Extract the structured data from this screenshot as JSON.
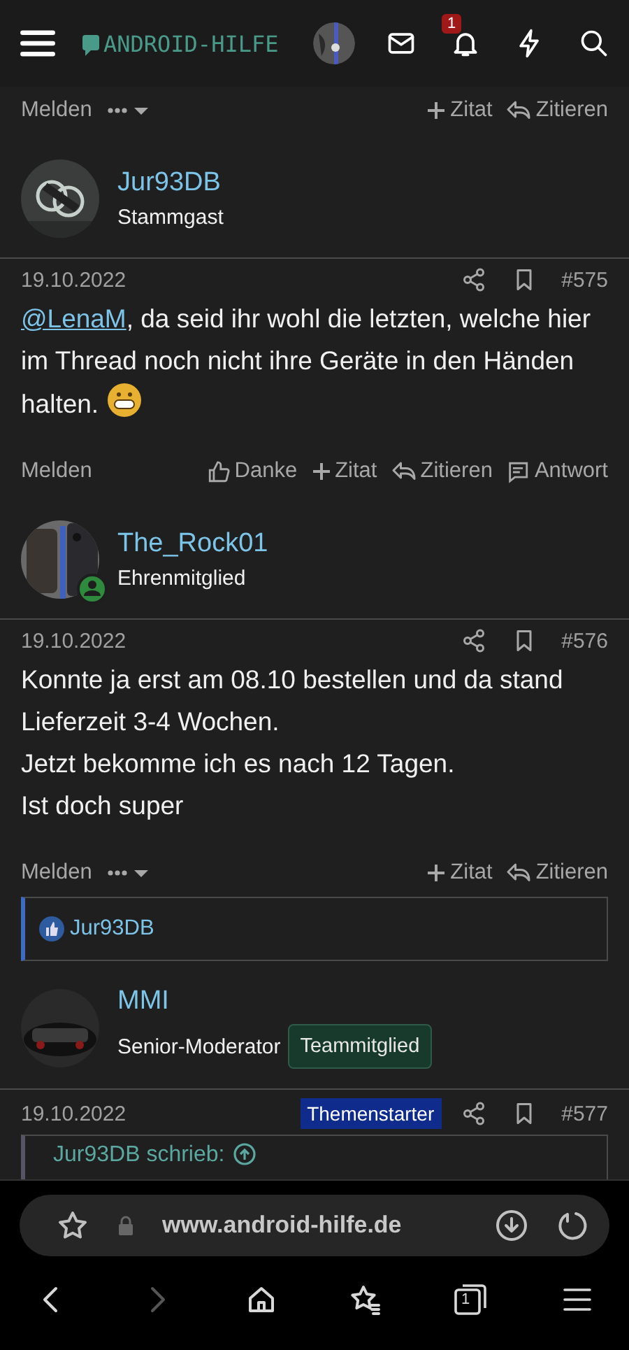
{
  "header": {
    "logo": "ANDROID-HILFE",
    "notification_count": "1"
  },
  "previous_post_actions": [
    {
      "kind": "report",
      "label": "Melden"
    },
    {
      "kind": "more"
    },
    {
      "kind": "quote",
      "label": "Zitat"
    },
    {
      "kind": "reply",
      "label": "Zitieren"
    }
  ],
  "posts": [
    {
      "author": {
        "name": "Jur93DB",
        "role": "Stammgast",
        "online": false
      },
      "date": "19.10.2022",
      "number": "#575",
      "body": [
        {
          "kind": "mention",
          "text": "@LenaM"
        },
        {
          "kind": "text",
          "text": ", da seid ihr wohl die letzten, welche hier im Thread noch nicht ihre Geräte in den Händen halten. "
        },
        {
          "kind": "emoji"
        }
      ],
      "actions": [
        {
          "kind": "report",
          "label": "Melden"
        },
        {
          "kind": "like",
          "label": "Danke"
        },
        {
          "kind": "quote",
          "label": "Zitat"
        },
        {
          "kind": "reply",
          "label": "Zitieren"
        },
        {
          "kind": "answer",
          "label": "Antwort"
        }
      ]
    },
    {
      "author": {
        "name": "The_Rock01",
        "role": "Ehrenmitglied",
        "online": true
      },
      "date": "19.10.2022",
      "number": "#576",
      "lines": [
        "Konnte ja erst am 08.10 bestellen und da stand Lieferzeit 3-4 Wochen.",
        "Jetzt bekomme ich es nach 12 Tagen.",
        "Ist doch super"
      ],
      "actions": [
        {
          "kind": "report",
          "label": "Melden"
        },
        {
          "kind": "more"
        },
        {
          "kind": "quote",
          "label": "Zitat"
        },
        {
          "kind": "reply",
          "label": "Zitieren"
        }
      ],
      "reactions": [
        "Jur93DB"
      ]
    },
    {
      "author": {
        "name": "MMI",
        "role": "Senior-Moderator",
        "badge": "Teammitglied",
        "online": false
      },
      "date": "19.10.2022",
      "starter_badge": "Themenstarter",
      "number": "#577",
      "quote_header": "Jur93DB schrieb:"
    }
  ],
  "browser": {
    "url": "www.android-hilfe.de",
    "tab_count": "1"
  }
}
